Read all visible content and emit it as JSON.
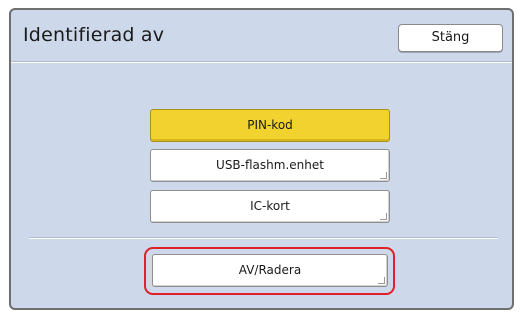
{
  "dialog": {
    "title": "Identifierad av",
    "close_label": "Stäng"
  },
  "options": [
    {
      "label": "PIN-kod",
      "selected": true
    },
    {
      "label": "USB-flashm.enhet",
      "selected": false
    },
    {
      "label": "IC-kort",
      "selected": false
    }
  ],
  "off_button": {
    "label": "AV/Radera",
    "highlighted": true
  },
  "colors": {
    "panel_background": "#cdd9ea",
    "selected_button": "#f2d22e",
    "highlight_outline": "#e0202a"
  }
}
